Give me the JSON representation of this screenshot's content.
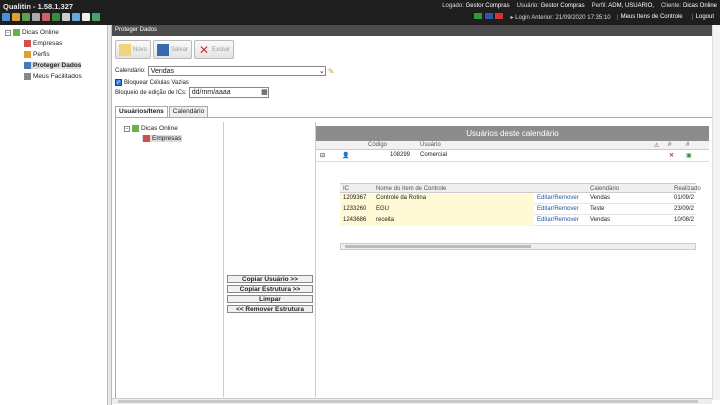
{
  "app": {
    "title": "Qualitin - 1.58.1.327"
  },
  "header": {
    "logado_label": "Logado:",
    "logado_value": "Gestor Compras",
    "usuario_label": "Usuário:",
    "usuario_value": "Gestor Compras",
    "perfil_label": "Perfil:",
    "perfil_value": "ADM, USUARIO,",
    "cliente_label": "Cliente:",
    "cliente_value": "Dicas Online",
    "login_anterior": "Login Anterior: 21/09/2020 17:35:10",
    "meus_itens": "Meus Itens de Controle",
    "logout": "Logout"
  },
  "sidebar": {
    "root": "Dicas Online",
    "items": [
      {
        "label": "Empresas"
      },
      {
        "label": "Perfis"
      },
      {
        "label": "Proteger Dados"
      },
      {
        "label": "Meus Facilitados"
      }
    ]
  },
  "panel": {
    "title": "Proteger Dados"
  },
  "toolbar": {
    "novo": "Novo",
    "salvar": "Salvar",
    "excluir": "Excluir"
  },
  "form": {
    "calendario_label": "Calendário:",
    "calendario_value": "Vendas",
    "bloquear_label": "Bloquear Células Vazias",
    "bloqueio_label": "Bloqueio de edição de ICs:",
    "date_placeholder": "dd/mm/aaaa"
  },
  "tabs": [
    {
      "label": "Usuários/Itens"
    },
    {
      "label": "Calendário"
    }
  ],
  "inner_tree": {
    "root": "Dicas Online",
    "child": "Empresas"
  },
  "actions": {
    "copiar_usuario": "Copiar Usuário >>",
    "copiar_estrutura": "Copiar Estrutura >>",
    "limpar": "Limpar",
    "remover": "<< Remover Estrutura"
  },
  "grid": {
    "title": "Usuários deste calendário",
    "col_codigo": "Código",
    "col_usuario": "Usuário",
    "col_hash1": "#",
    "col_hash2": "#",
    "row": {
      "codigo": "108299",
      "usuario": "Comercial"
    },
    "sub": {
      "col_ic": "IC",
      "col_nome": "Nome do Item de Controle",
      "col_calendario": "Calendário",
      "col_realizado": "Realizado",
      "rows": [
        {
          "ic": "1209367",
          "nome": "Controle da Rotina",
          "acao": "Editar/Remover",
          "calendario": "Vendas",
          "realizado": "01/09/2"
        },
        {
          "ic": "1233260",
          "nome": "EGU",
          "acao": "Editar/Remover",
          "calendario": "Teste",
          "realizado": "23/09/2"
        },
        {
          "ic": "1243686",
          "nome": "receita",
          "acao": "Editar/Remover",
          "calendario": "Vendas",
          "realizado": "10/08/2"
        }
      ]
    }
  },
  "colors": {
    "topbar": "#1e1e1e",
    "panel_title": "#4b4b4b",
    "grid_header": "#8c8c8c",
    "highlight": "#fff9d6",
    "link": "#2255aa"
  }
}
